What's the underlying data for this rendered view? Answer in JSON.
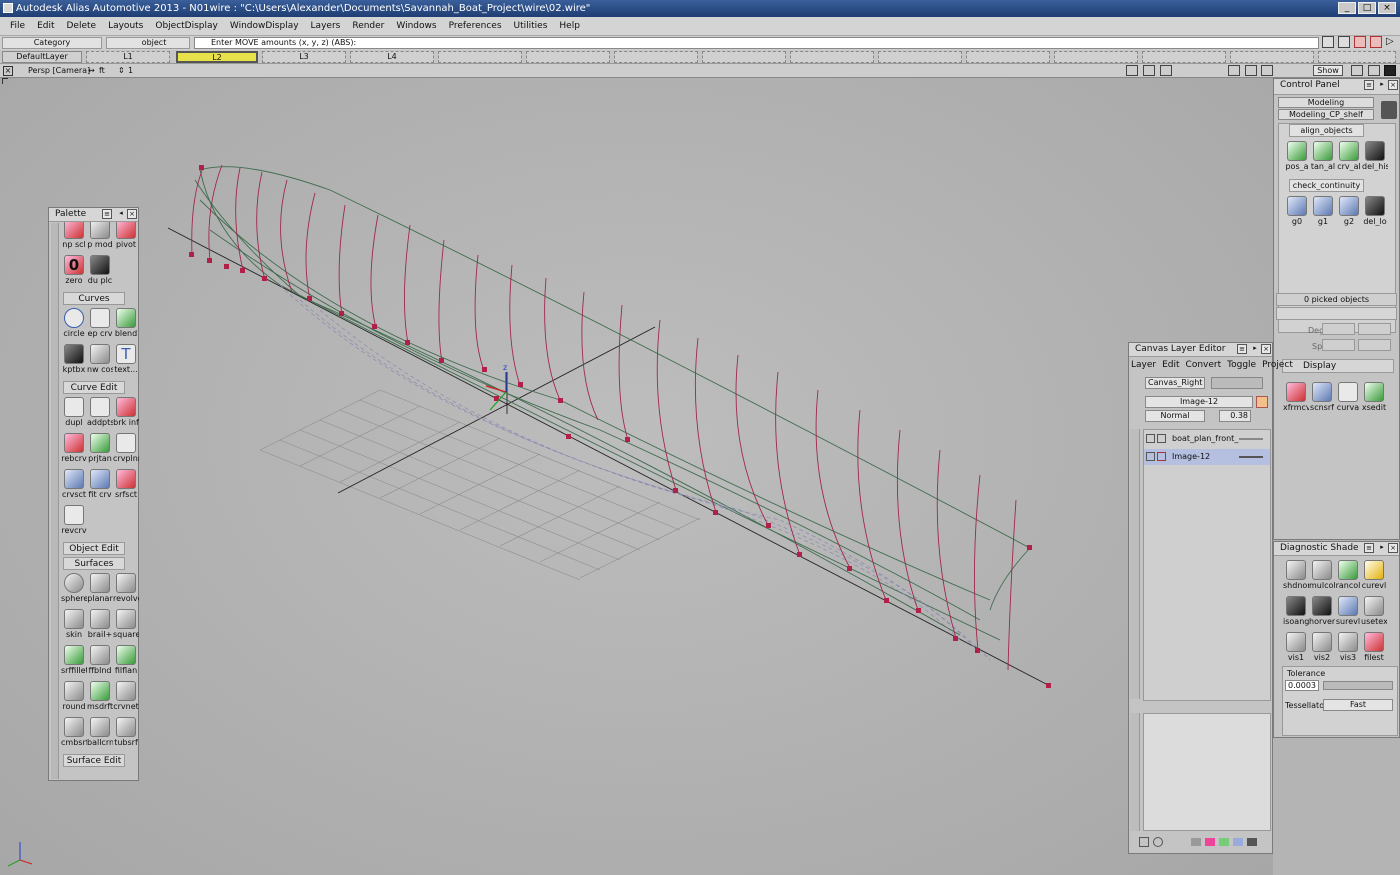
{
  "window": {
    "title": "Autodesk Alias Automotive 2013 - N01wire : \"C:\\Users\\Alexander\\Documents\\Savannah_Boat_Project\\wire\\02.wire\""
  },
  "menu": [
    "File",
    "Edit",
    "Delete",
    "Layouts",
    "ObjectDisplay",
    "WindowDisplay",
    "Layers",
    "Render",
    "Windows",
    "Preferences",
    "Utilities",
    "Help"
  ],
  "command": {
    "category": "Category",
    "object": "object",
    "prompt": "Enter MOVE amounts (x, y, z) (ABS):"
  },
  "layers": {
    "default": "DefaultLayer",
    "items": [
      "L1",
      "L2",
      "L3",
      "L4"
    ],
    "active": "L2",
    "active_color": "#e8e24a"
  },
  "viewport": {
    "camera": "Persp [Camera]",
    "units": "ft",
    "count": "1",
    "show": "Show",
    "axis": "z"
  },
  "palette": {
    "title": "Palette",
    "top_tools": [
      "np scl",
      "p mod",
      "pivot",
      "zero",
      "du plc"
    ],
    "sections": [
      {
        "title": "Curves",
        "tools": [
          "circle",
          "ep crv",
          "blend",
          "kptbx",
          "nw cos",
          "text..."
        ]
      },
      {
        "title": "Curve Edit",
        "tools": [
          "dupl",
          "addpts",
          "brk inf",
          "rebcrv",
          "prjtan",
          "crvplnr",
          "crvsct",
          "fit crv",
          "srfsct",
          "revcrv"
        ]
      },
      {
        "title": "Object Edit",
        "tools": []
      },
      {
        "title": "Surfaces",
        "tools": [
          "sphere",
          "planar",
          "revolve",
          "skin",
          "brail+",
          "square",
          "srffillet",
          "ffblnd",
          "filflan",
          "round",
          "msdrft",
          "crvnet",
          "cmbsrf",
          "ballcrn",
          "tubsrf"
        ]
      },
      {
        "title": "Surface Edit",
        "tools": []
      }
    ]
  },
  "control_panel": {
    "title": "Control Panel",
    "mode": "Modeling",
    "shelf": "Modeling_CP_shelf",
    "align_label": "align_objects",
    "align_tools": [
      "pos_a",
      "tan_al",
      "crv_al",
      "del_his"
    ],
    "check_label": "check_continuity",
    "check_tools": [
      "g0",
      "g1",
      "g2",
      "del_lo"
    ],
    "picked": "0 picked objects",
    "degree_label": "Degree",
    "spans_label": "Spans",
    "display_label": "Display",
    "display_tools": [
      "xfrmcv",
      "scnsrf",
      "curva",
      "xsedit"
    ]
  },
  "canvas_layer_editor": {
    "title": "Canvas Layer Editor",
    "menu": [
      "Layer",
      "Edit",
      "Convert",
      "Toggle",
      "Project"
    ],
    "canvas": "Canvas_Right",
    "image": "Image-12",
    "blend": "Normal",
    "opacity": "0.38",
    "rows": [
      "boat_plan_front_",
      "Image-12"
    ]
  },
  "diagnostic_shade": {
    "title": "Diagnostic Shade",
    "tools": [
      "shdnon",
      "mulcol",
      "rancol",
      "curevl",
      "isoang",
      "horver",
      "surevl",
      "usetex",
      "vis1",
      "vis2",
      "vis3",
      "filest"
    ],
    "tolerance_label": "Tolerance",
    "tolerance": "0.0003",
    "tessellator_label": "Tessellator",
    "tessellator": "Fast"
  }
}
